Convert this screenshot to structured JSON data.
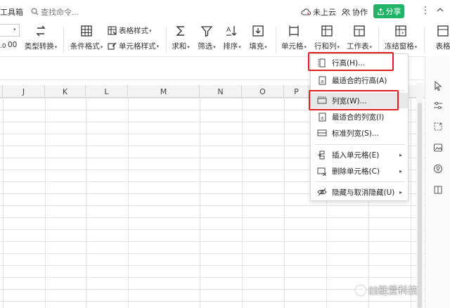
{
  "menu": {
    "tools_tab": "工具箱"
  },
  "search": {
    "placeholder": "查找命令..."
  },
  "topright": {
    "cloud_label": "未上云",
    "collab_label": "协作",
    "share_label": "分享"
  },
  "ribbon": {
    "type_convert": "类型转换",
    "cond_format": "条件格式",
    "table_style": "表格样式",
    "cell_style": "单元格样式",
    "sum": "求和",
    "filter": "筛选",
    "sort": "排序",
    "fill": "填充",
    "cell": "单元格",
    "row_col": "行和列",
    "worksheet": "工作表",
    "freeze": "冻结窗格",
    "table_tools": "表格",
    "decimal_hint": "00"
  },
  "columns": [
    "J",
    "K",
    "L",
    "M",
    "N",
    "O",
    "P"
  ],
  "dropdown": {
    "items": [
      {
        "label": "行高(H)...",
        "icon": "row-height-icon"
      },
      {
        "label": "最适合的行高(A)",
        "icon": "best-fit-row-icon"
      },
      {
        "label": "列宽(W)...",
        "icon": "column-width-icon"
      },
      {
        "label": "最适合的列宽(I)",
        "icon": "best-fit-column-icon"
      },
      {
        "label": "标准列宽(S)...",
        "icon": "standard-width-icon"
      },
      {
        "label": "插入单元格(E)",
        "icon": "insert-cell-icon"
      },
      {
        "label": "删除单元格(C)",
        "icon": "delete-cell-icon"
      },
      {
        "label": "隐藏与取消隐藏(U)",
        "icon": "hide-unhide-icon"
      }
    ]
  },
  "watermark": {
    "text": "凶能爱科技"
  },
  "colors": {
    "share_green": "#1fb468",
    "highlight_red": "#e01f1f"
  }
}
